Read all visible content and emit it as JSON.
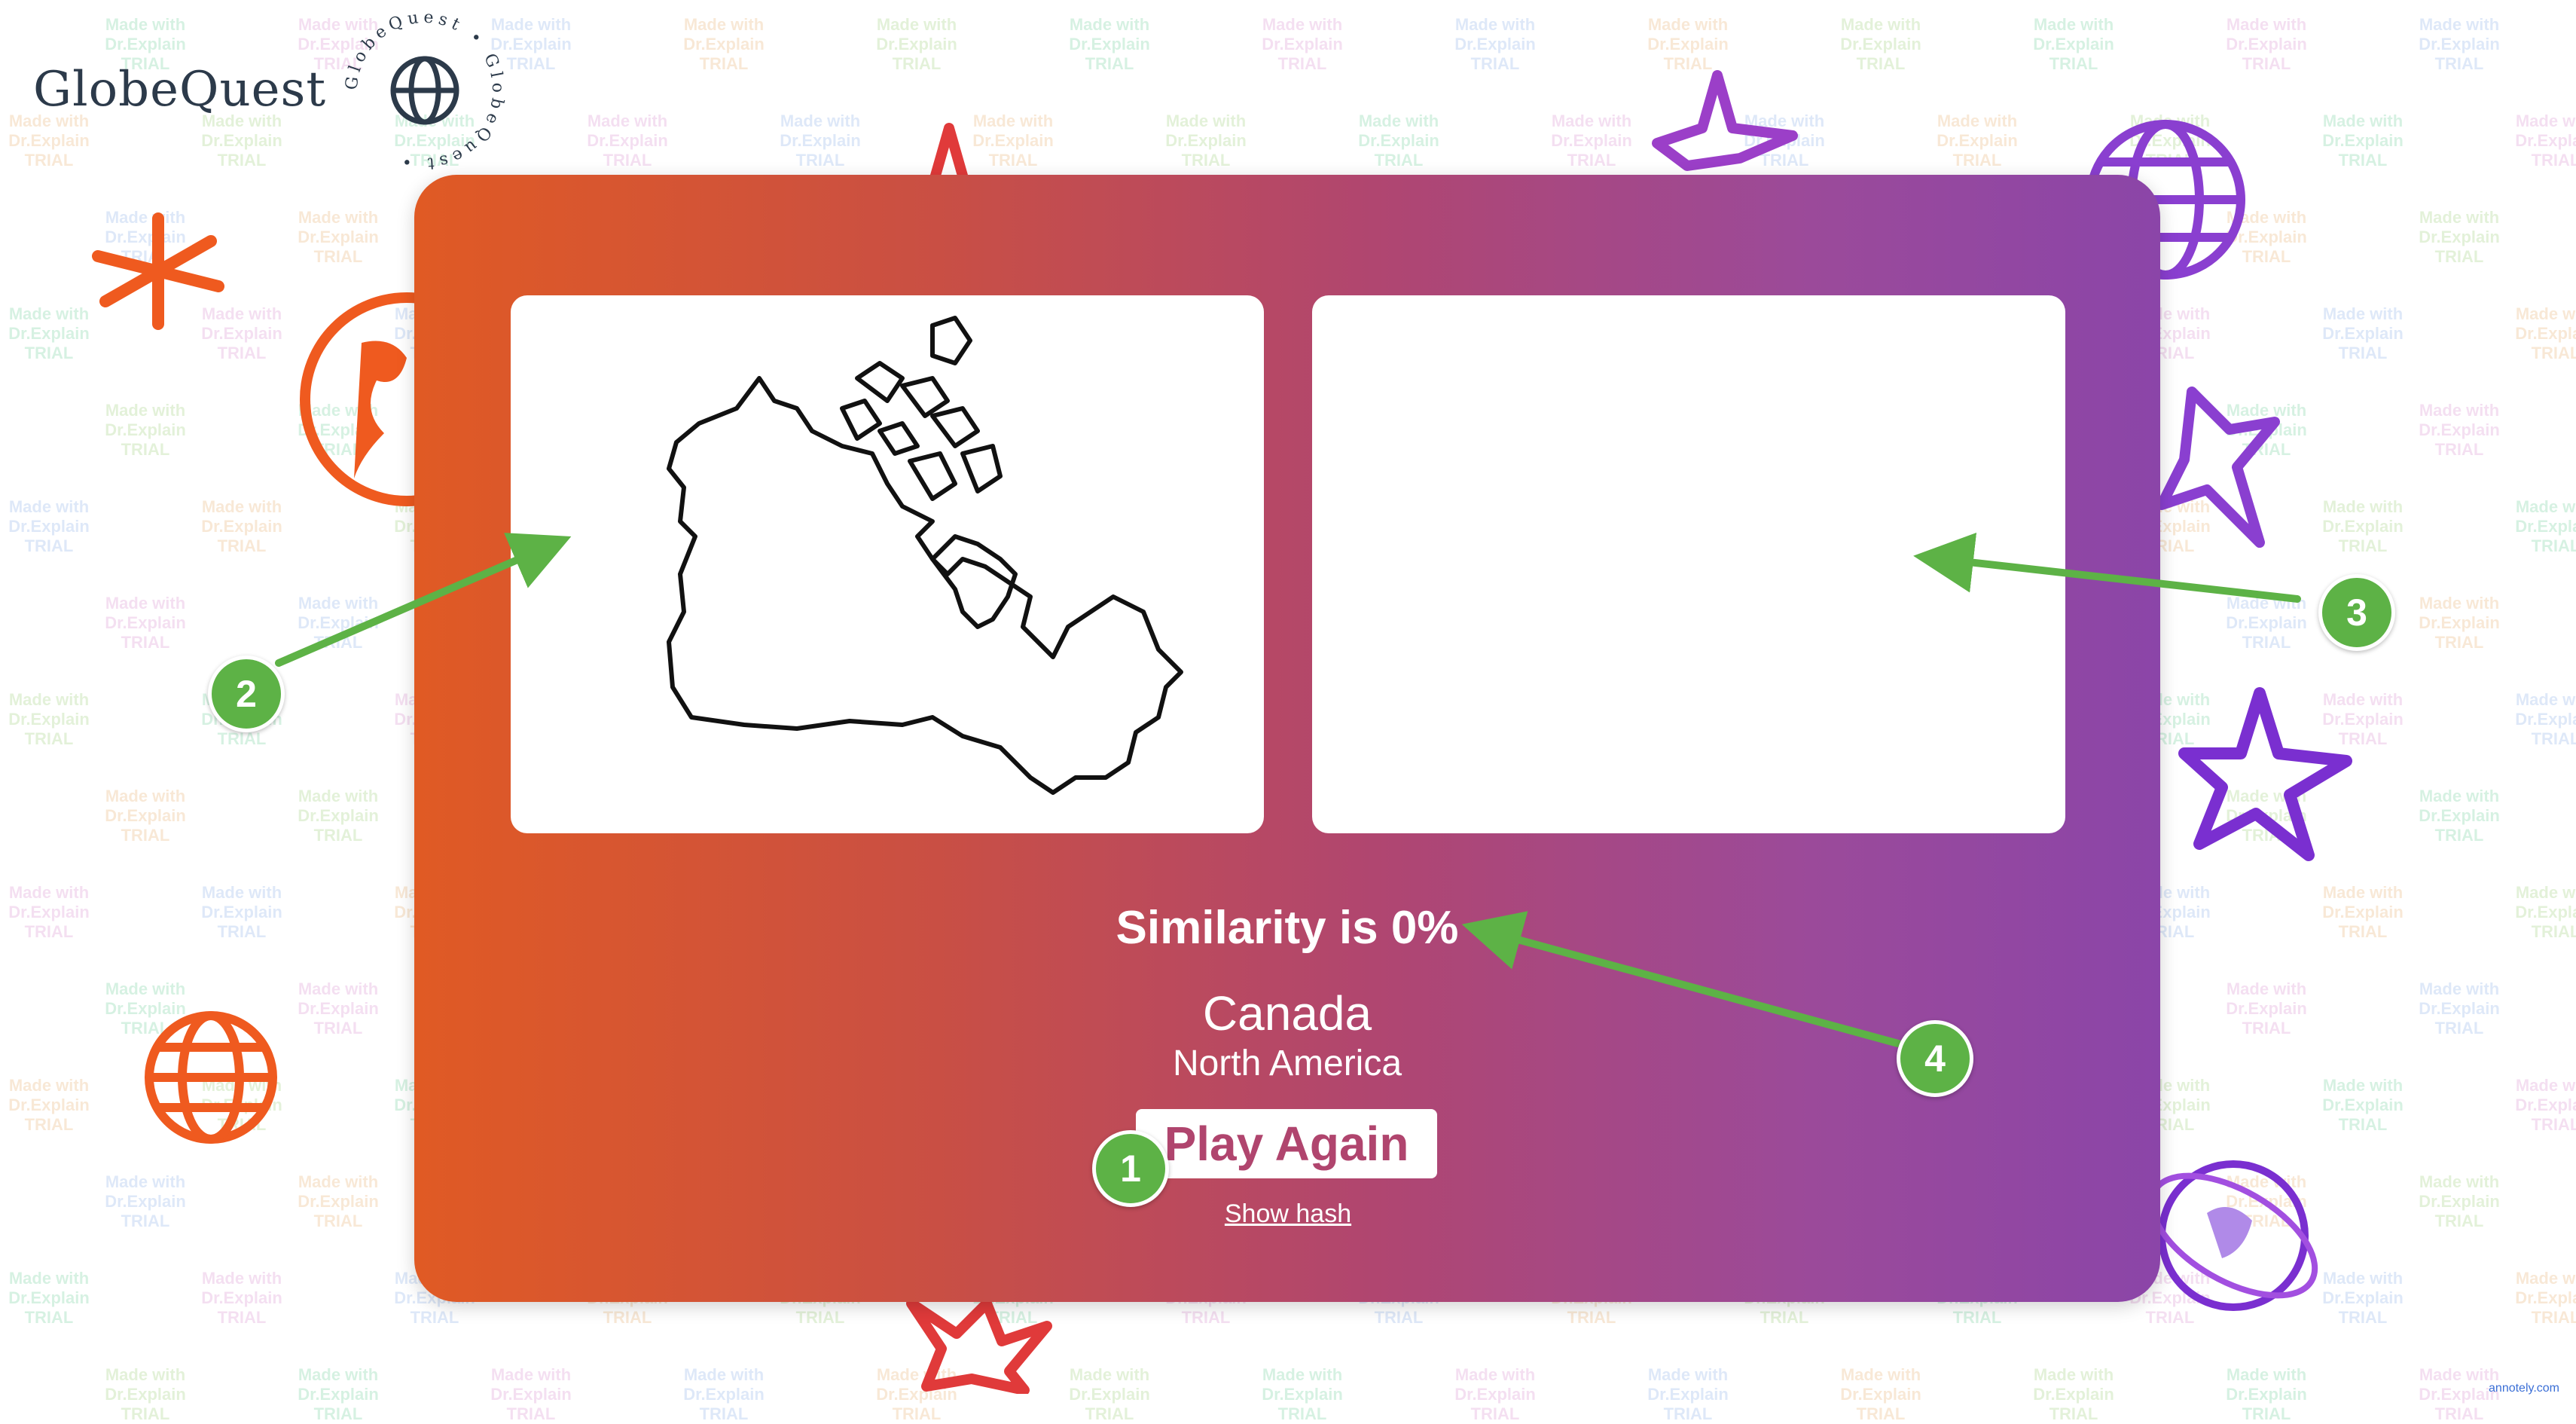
{
  "brand": {
    "name": "GlobeQuest",
    "ring_text": "GlobeQuest • GlobeQuest •",
    "globe_icon": "globe-icon"
  },
  "watermark": {
    "lines": [
      "Made with",
      "Dr.Explain",
      "TRIAL"
    ]
  },
  "game": {
    "similarity_text": "Similarity is 0%",
    "country": "Canada",
    "continent": "North America",
    "play_again_label": "Play Again",
    "show_hash_label": "Show hash",
    "left_panel": "canada-outline-map",
    "right_panel": "empty-drawing-canvas"
  },
  "callouts": [
    {
      "number": "1",
      "target": "play-again-button"
    },
    {
      "number": "2",
      "target": "reference-map-panel"
    },
    {
      "number": "3",
      "target": "drawing-canvas-panel"
    },
    {
      "number": "4",
      "target": "similarity-text"
    }
  ],
  "footer": {
    "credit": "annotely.com"
  },
  "colors": {
    "card_gradient_start": "#e05a24",
    "card_gradient_end": "#8b45a8",
    "callout_green": "#5db246",
    "button_text": "#b0456e"
  }
}
